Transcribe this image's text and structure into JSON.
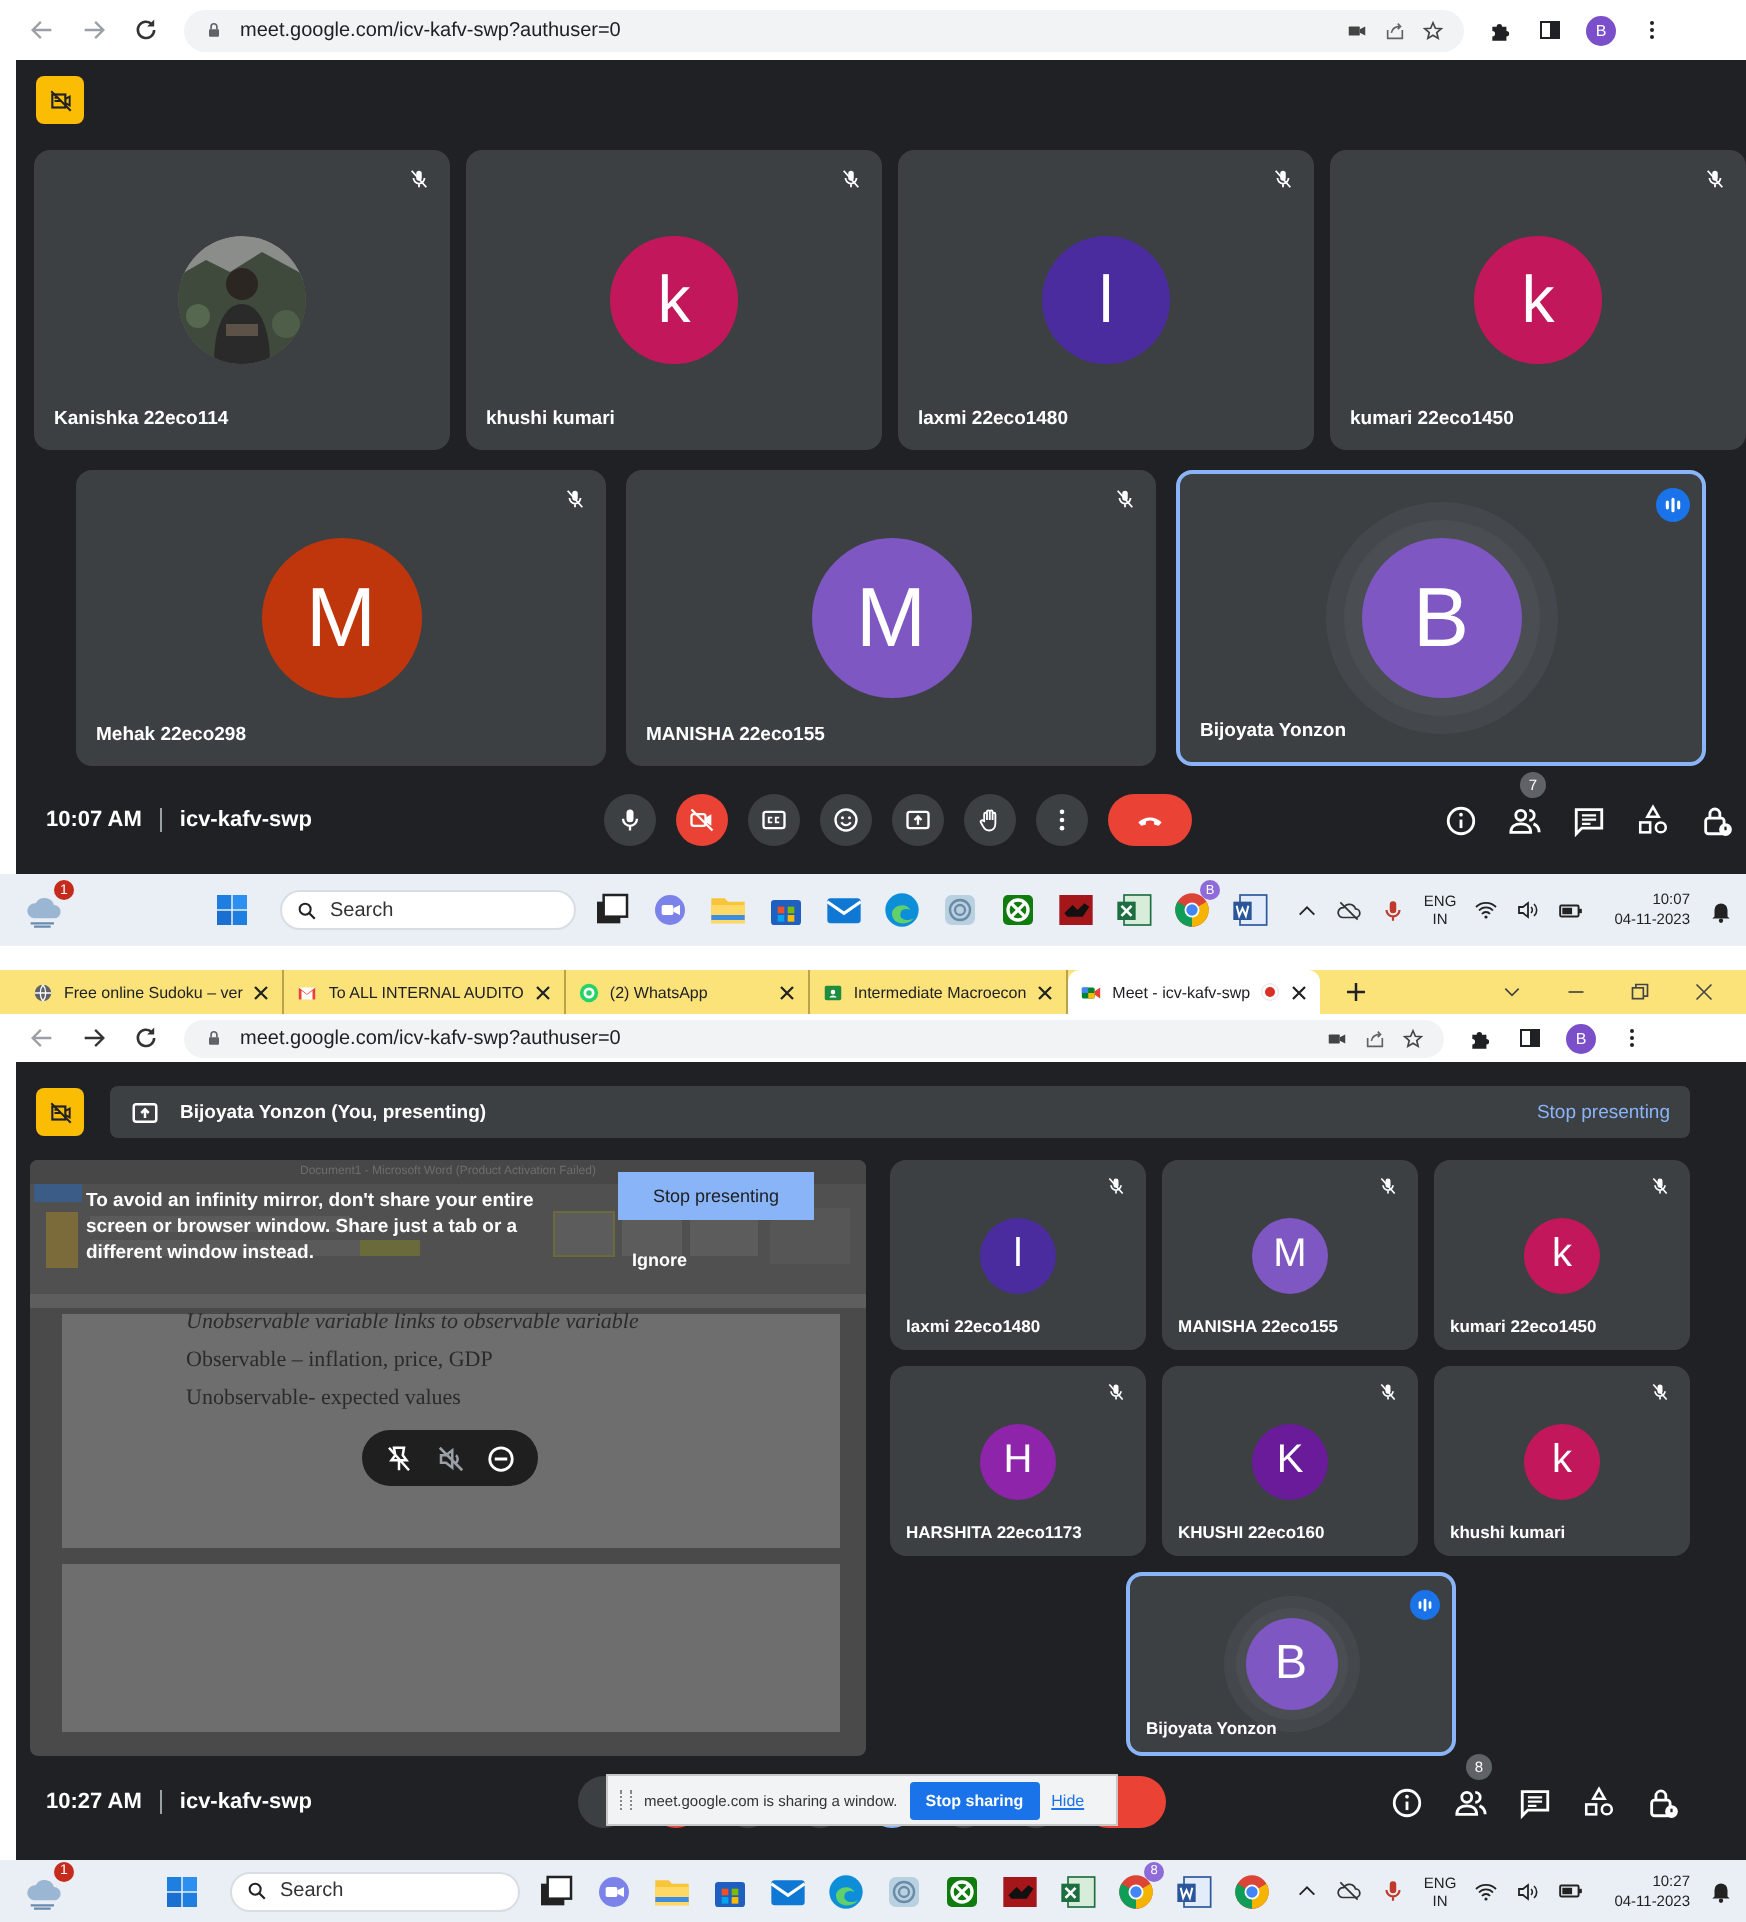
{
  "captures": [
    {
      "address_bar": {
        "url": "meet.google.com/icv-kafv-swp?authuser=0",
        "profile_initial": "B"
      },
      "meet": {
        "top_row": [
          {
            "name": "Kanishka 22eco114",
            "muted": true,
            "speaking": false
          },
          {
            "name": "khushi kumari",
            "kind": "letter",
            "initial": "k",
            "color": "#c2185b",
            "muted": true,
            "speaking": false
          },
          {
            "name": "laxmi 22eco1480",
            "kind": "letter",
            "initial": "l",
            "color": "#4a2c9e",
            "muted": true,
            "speaking": false
          },
          {
            "name": "kumari 22eco1450",
            "kind": "letter",
            "initial": "k",
            "color": "#c2185b",
            "muted": true,
            "speaking": false
          }
        ],
        "bottom_row": [
          {
            "name": "Mehak 22eco298",
            "kind": "letter",
            "initial": "M",
            "color": "#bf360c",
            "muted": true,
            "speaking": false
          },
          {
            "name": "MANISHA 22eco155",
            "kind": "letter",
            "initial": "M",
            "color": "#7e57c2",
            "muted": true,
            "speaking": false
          },
          {
            "name": "Bijoyata Yonzon",
            "kind": "letter",
            "initial": "B",
            "color": "#7e57c2",
            "muted": false,
            "speaking": true
          }
        ],
        "time": "10:07 AM",
        "meeting_code": "icv-kafv-swp",
        "mic_on": true,
        "camera_on": false,
        "presenting": false,
        "people_count": "7"
      },
      "taskbar": {
        "weather_badge": "1",
        "search": {
          "placeholder": "Search"
        },
        "apps": [
          {
            "kind": "taskview"
          },
          {
            "kind": "chat"
          },
          {
            "kind": "folder"
          },
          {
            "kind": "store"
          },
          {
            "kind": "mail"
          },
          {
            "kind": "edge"
          },
          {
            "kind": "print"
          },
          {
            "kind": "xbox"
          },
          {
            "kind": "redapp"
          },
          {
            "kind": "excel"
          },
          {
            "kind": "chrome",
            "badge": "B"
          },
          {
            "kind": "word"
          }
        ],
        "language": "ENG",
        "region": "IN",
        "time": "10:07",
        "date": "04-11-2023"
      }
    },
    {
      "tabs": [
        {
          "title": "Free online Sudoku – ver",
          "kind": "globe",
          "selected": false
        },
        {
          "title": "To ALL INTERNAL AUDITO",
          "kind": "mail",
          "selected": false
        },
        {
          "title": "(2) WhatsApp",
          "kind": "chat",
          "selected": false
        },
        {
          "title": "Intermediate Macroecon",
          "kind": "board",
          "selected": false
        },
        {
          "title": "Meet - icv-kafv-swp",
          "kind": "meet",
          "selected": true,
          "recording": true
        }
      ],
      "address_bar": {
        "url": "meet.google.com/icv-kafv-swp?authuser=0",
        "profile_initial": "B"
      },
      "meet": {
        "banner": {
          "text": "Bijoyata Yonzon (You, presenting)",
          "action": "Stop presenting"
        },
        "shared_window": {
          "title": "Document1 - Microsoft Word (Product Activation Failed)",
          "lines": [
            "Unobservable variable links to observable variable",
            "Observable – inflation, price, GDP",
            "Unobservable- expected values"
          ],
          "warning": "To avoid an infinity mirror, don't share your entire screen or browser window. Share just a tab or a different window instead.",
          "stop_button": "Stop presenting",
          "ignore_button": "Ignore"
        },
        "tiles": [
          {
            "name": "laxmi 22eco1480",
            "kind": "letter",
            "initial": "l",
            "color": "#4a2c9e",
            "muted": true,
            "speaking": false
          },
          {
            "name": "MANISHA 22eco155",
            "kind": "letter",
            "initial": "M",
            "color": "#7e57c2",
            "muted": true,
            "speaking": false
          },
          {
            "name": "kumari 22eco1450",
            "kind": "letter",
            "initial": "k",
            "color": "#c2185b",
            "muted": true,
            "speaking": false
          },
          {
            "name": "HARSHITA 22eco1173",
            "kind": "letter",
            "initial": "H",
            "color": "#8e24aa",
            "muted": true,
            "speaking": false
          },
          {
            "name": "KHUSHI 22eco160",
            "kind": "letter",
            "initial": "K",
            "color": "#6a1b9a",
            "muted": true,
            "speaking": false
          },
          {
            "name": "khushi kumari",
            "kind": "letter",
            "initial": "k",
            "color": "#c2185b",
            "muted": true,
            "speaking": false
          }
        ],
        "self_tile": {
          "name": "Bijoyata Yonzon",
          "kind": "letter",
          "initial": "B",
          "color": "#7e57c2",
          "muted": false,
          "speaking": true
        },
        "time": "10:27 AM",
        "meeting_code": "icv-kafv-swp",
        "mic_on": true,
        "camera_on": false,
        "presenting": true,
        "people_count": "8",
        "sharing_notice": {
          "message": "meet.google.com is sharing a window.",
          "stop_button": "Stop sharing",
          "hide_link": "Hide"
        }
      },
      "taskbar": {
        "weather_badge": "1",
        "search": {
          "placeholder": "Search"
        },
        "apps": [
          {
            "kind": "taskview"
          },
          {
            "kind": "chat"
          },
          {
            "kind": "folder"
          },
          {
            "kind": "store"
          },
          {
            "kind": "mail"
          },
          {
            "kind": "edge"
          },
          {
            "kind": "print"
          },
          {
            "kind": "xbox"
          },
          {
            "kind": "redapp"
          },
          {
            "kind": "excel"
          },
          {
            "kind": "chrome",
            "badge": "8"
          },
          {
            "kind": "word"
          },
          {
            "kind": "chrome"
          }
        ],
        "language": "ENG",
        "region": "IN",
        "time": "10:27",
        "date": "04-11-2023"
      }
    }
  ]
}
